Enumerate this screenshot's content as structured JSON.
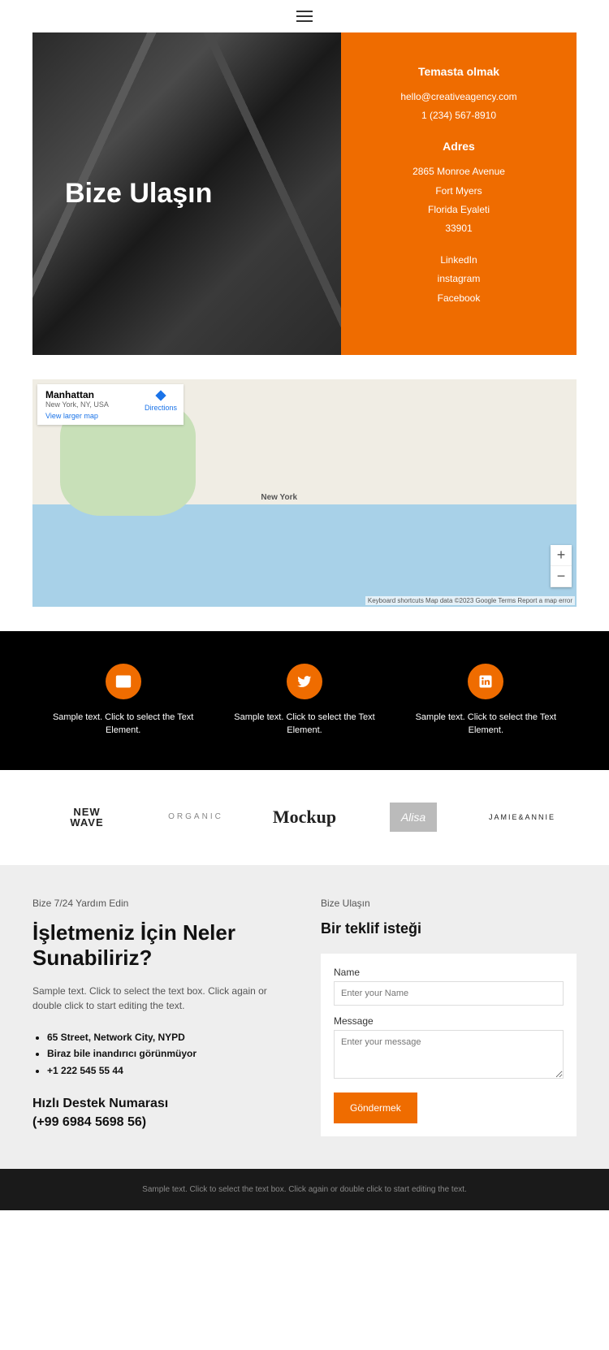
{
  "hero": {
    "title": "Bize Ulaşın"
  },
  "contact": {
    "heading1": "Temasta olmak",
    "email": "hello@creativeagency.com",
    "phone": "1 (234) 567-8910",
    "heading2": "Adres",
    "addr1": "2865 Monroe Avenue",
    "addr2": "Fort Myers",
    "addr3": "Florida Eyaleti",
    "addr4": "33901",
    "social1": "LinkedIn",
    "social2": "instagram",
    "social3": "Facebook"
  },
  "map": {
    "title": "Manhattan",
    "subtitle": "New York, NY, USA",
    "viewLarger": "View larger map",
    "directions": "Directions",
    "label_ny": "New York",
    "zoomIn": "+",
    "zoomOut": "−",
    "attrib": "Keyboard shortcuts   Map data ©2023 Google   Terms   Report a map error"
  },
  "social": {
    "text1": "Sample text. Click to select the Text Element.",
    "text2": "Sample text. Click to select the Text Element.",
    "text3": "Sample text. Click to select the Text Element."
  },
  "logos": {
    "l1a": "NEW",
    "l1b": "WAVE",
    "l2": "ORGANIC",
    "l3": "Mockup",
    "l4": "Alisa",
    "l5": "JAMIE&ANNIE"
  },
  "formSection": {
    "leftSmall": "Bize 7/24 Yardım Edin",
    "leftBig": "İşletmeniz İçin Neler Sunabiliriz?",
    "leftDesc": "Sample text. Click to select the text box. Click again or double click to start editing the text.",
    "bullet1": "65 Street, Network City, NYPD",
    "bullet2": "Biraz bile inandırıcı görünmüyor",
    "bullet3": "+1 222 545 55 44",
    "supportTitle": "Hızlı Destek Numarası",
    "supportNumber": "(+99 6984 5698 56)",
    "rightSmall": "Bize Ulaşın",
    "rightBig": "Bir teklif isteği",
    "nameLabel": "Name",
    "namePlaceholder": "Enter your Name",
    "messageLabel": "Message",
    "messagePlaceholder": "Enter your message",
    "submit": "Göndermek"
  },
  "footer": {
    "text": "Sample text. Click to select the text box. Click again or double click to start editing the text."
  }
}
